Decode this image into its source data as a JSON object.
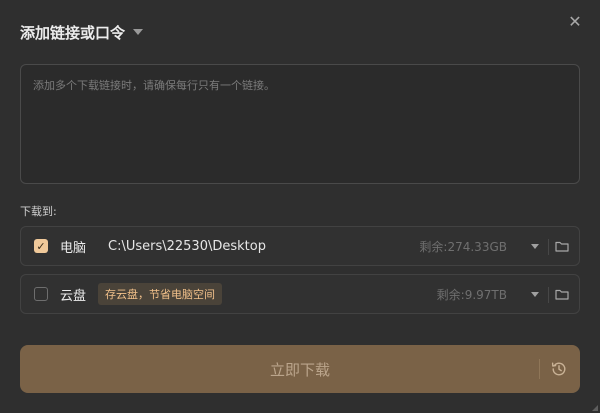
{
  "dialog": {
    "title": "添加链接或口令",
    "close_icon": "close-icon"
  },
  "link_input": {
    "placeholder": "添加多个下载链接时，请确保每行只有一个链接。",
    "value": ""
  },
  "destination": {
    "label": "下载到:",
    "items": [
      {
        "name": "电脑",
        "checked": true,
        "path": "C:\\Users\\22530\\Desktop",
        "free": "剩余:274.33GB"
      },
      {
        "name": "云盘",
        "checked": false,
        "tag": "存云盘，节省电脑空间",
        "free": "剩余:9.97TB"
      }
    ]
  },
  "download_button": {
    "label": "立即下载"
  },
  "colors": {
    "accent_button": "#7a6247",
    "checkbox_on": "#f0c99a",
    "tag_text": "#f1c08a"
  }
}
